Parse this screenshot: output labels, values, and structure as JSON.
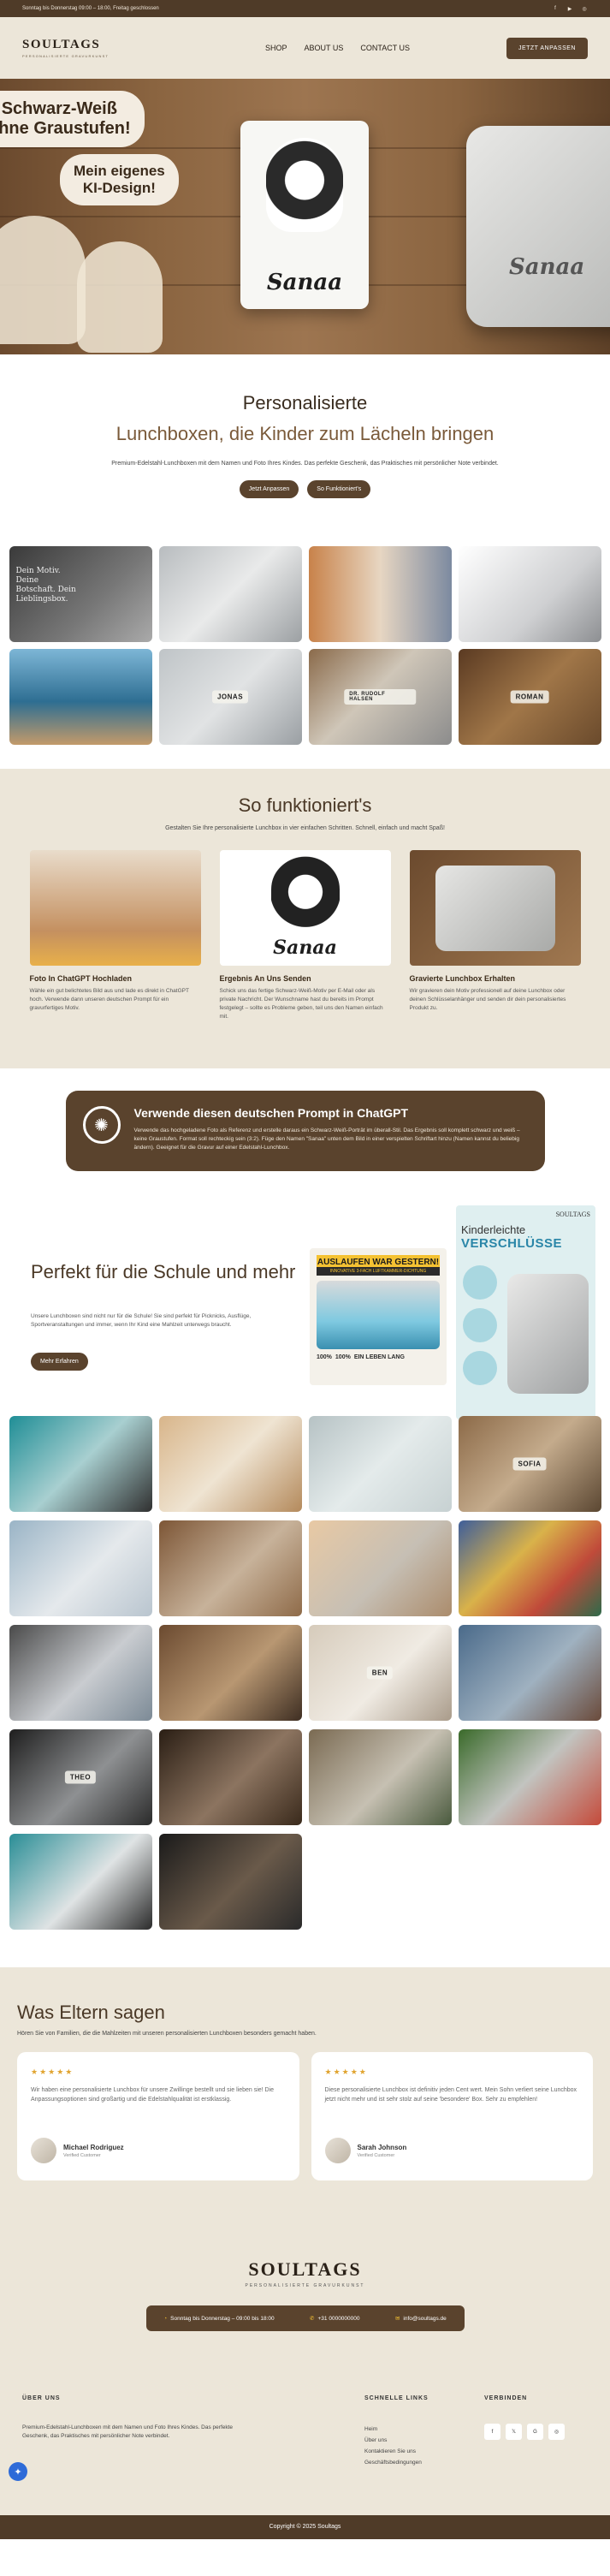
{
  "topbar": {
    "hours": "Sonntag bis Donnerstag 09:00 – 18:00, Freitag geschlossen",
    "social": [
      "facebook-icon",
      "youtube-icon",
      "instagram-icon"
    ]
  },
  "header": {
    "logo_name": "SOULTAGS",
    "logo_sub": "PERSONALISIERTE GRAVURKUNST",
    "nav": [
      "SHOP",
      "ABOUT US",
      "CONTACT US"
    ],
    "cta": "JETZT ANPASSEN"
  },
  "hero": {
    "bubble_left": "Schwarz-Weiß\nohne Graustufen!",
    "bubble_right": "Mein eigenes\nKI-Design!",
    "card_name": "Sanaa"
  },
  "intro": {
    "title": "Personalisierte",
    "subtitle": "Lunchboxen, die Kinder zum Lächeln bringen",
    "text": "Premium-Edelstahl-Lunchboxen mit dem Namen und Foto Ihres Kindes. Das perfekte Geschenk, das Praktisches mit persönlicher Note verbindet.",
    "btn_primary": "Jetzt Anpassen",
    "btn_secondary": "So Funktioniert's"
  },
  "gallery1": [
    {
      "label": "Dein Motiv. Deine Botschaft. Dein Lieblingsbox."
    },
    {
      "label": ""
    },
    {
      "label": ""
    },
    {
      "label": ""
    },
    {
      "label": ""
    },
    {
      "label": "JONAS"
    },
    {
      "label": "DR. RUDOLF HALSEN"
    },
    {
      "label": "ROMAN"
    }
  ],
  "how": {
    "title": "So funktioniert's",
    "sub": "Gestalten Sie Ihre personalisierte Lunchbox in vier einfachen Schritten. Schnell, einfach und macht Spaß!",
    "steps": [
      {
        "title": "Foto In ChatGPT Hochladen",
        "text": "Wähle ein gut belichtetes Bild aus und lade es direkt in ChatGPT hoch. Verwende dann unseren deutschen Prompt für ein gravurfertiges Motiv."
      },
      {
        "title": "Ergebnis An Uns Senden",
        "text": "Schick uns das fertige Schwarz-Weiß-Motiv per E-Mail oder als private Nachricht. Der Wunschname hast du bereits im Prompt festgelegt – sollte es Probleme geben, teil uns den Namen einfach mit."
      },
      {
        "title": "Gravierte Lunchbox Erhalten",
        "text": "Wir gravieren dein Motiv professionell auf deine Lunchbox oder deinen Schlüsselanhänger und senden dir dein personalisiertes Produkt zu."
      }
    ],
    "sample_name": "Sanaa"
  },
  "prompt": {
    "title": "Verwende diesen deutschen Prompt in ChatGPT",
    "text": "Verwende das hochgeladene Foto als Referenz und erstelle daraus ein Schwarz-Weiß-Porträt im überall-Stil. Das Ergebnis soll komplett schwarz und weiß – keine Graustufen. Format soll rechteckig sein (3:2). Füge den Namen \"Sanaa\" unten dem Bild in einer verspielten Schriftart hinzu (Namen kannst du beliebig ändern). Geeignet für die Gravur auf einer Edelstahl-Lunchbox."
  },
  "school": {
    "title": "Perfekt für die Schule und mehr",
    "text": "Unsere Lunchboxen sind nicht nur für die Schule! Sie sind perfekt für Picknicks, Ausflüge, Sportveranstaltungen und immer, wenn Ihr Kind eine Mahlzeit unterwegs braucht.",
    "btn": "Mehr Erfahren",
    "promo1_head": "AUSLAUFEN WAR GESTERN!",
    "promo1_sub": "INNOVATIVE 3-FACH LUFTKAMMER-DICHTUNG",
    "promo1_badges": [
      "100%",
      "100%",
      "EIN LEBEN LANG"
    ],
    "promo2_brand": "SOULTAGS",
    "promo2_t1": "Kinderleichte",
    "promo2_t2": "VERSCHLÜSSE"
  },
  "gallery2": [
    {
      "label": ""
    },
    {
      "label": ""
    },
    {
      "label": ""
    },
    {
      "label": "SOFIA"
    },
    {
      "label": ""
    },
    {
      "label": ""
    },
    {
      "label": ""
    },
    {
      "label": ""
    },
    {
      "label": ""
    },
    {
      "label": ""
    },
    {
      "label": "BEN"
    },
    {
      "label": ""
    },
    {
      "label": "THEO"
    },
    {
      "label": ""
    },
    {
      "label": ""
    },
    {
      "label": ""
    },
    {
      "label": ""
    },
    {
      "label": ""
    }
  ],
  "testimonials": {
    "title": "Was Eltern sagen",
    "sub": "Hören Sie von Familien, die die Mahlzeiten mit unseren personalisierten Lunchboxen besonders gemacht haben.",
    "items": [
      {
        "stars": "★★★★★",
        "text": "Wir haben eine personalisierte Lunchbox für unsere Zwillinge bestellt und sie lieben sie! Die Anpassungsoptionen sind großartig und die Edelstahlqualität ist erstklassig.",
        "name": "Michael Rodriguez",
        "role": "Verified Customer"
      },
      {
        "stars": "★★★★★",
        "text": "Diese personalisierte Lunchbox ist definitiv jeden Cent wert. Mein Sohn verliert seine Lunchbox jetzt nicht mehr und ist sehr stolz auf seine 'besondere' Box. Sehr zu empfehlen!",
        "name": "Sarah Johnson",
        "role": "Verified Customer"
      }
    ]
  },
  "footer": {
    "logo_name": "SOULTAGS",
    "logo_sub": "PERSONALISIERTE GRAVURKUNST",
    "contact_hours": "Sonntag bis Donnerstag – 09:00 bis 18:00",
    "contact_phone": "+31 0000000000",
    "contact_email": "info@soultags.de",
    "about_title": "ÜBER UNS",
    "about_text": "Premium-Edelstahl-Lunchboxen mit dem Namen und Foto Ihres Kindes. Das perfekte Geschenk, das Praktisches mit persönlicher Note verbindet.",
    "links_title": "SCHNELLE LINKS",
    "links": [
      "Heim",
      "Über uns",
      "Kontaktieren Sie uns",
      "Geschäftsbedingungen"
    ],
    "connect_title": "VERBINDEN",
    "copyright": "Copyright © 2025 Soultags"
  },
  "colors": {
    "brand": "#5a432d",
    "beige": "#ece6d9",
    "accent": "#e0a430"
  }
}
